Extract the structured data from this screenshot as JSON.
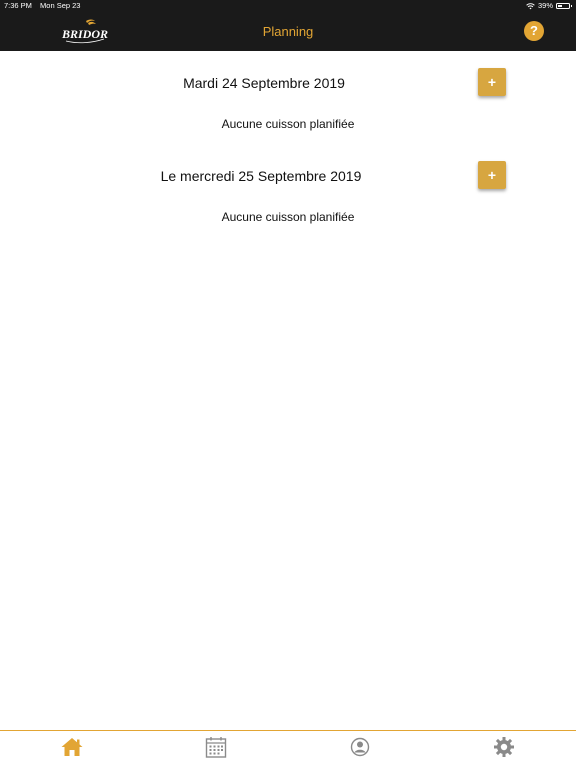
{
  "status_bar": {
    "time": "7:36 PM",
    "date": "Mon Sep 23",
    "battery": "39%",
    "battery_level": 0.39
  },
  "header": {
    "logo_text": "BRIDOR",
    "title": "Planning",
    "help_label": "?"
  },
  "days": [
    {
      "title": "Mardi 24 Septembre 2019",
      "add_label": "+",
      "empty_message": "Aucune cuisson planifiée"
    },
    {
      "title": "Le mercredi 25 Septembre 2019",
      "add_label": "+",
      "empty_message": "Aucune cuisson planifiée"
    }
  ],
  "tab_bar": {
    "active_tab": "home",
    "tabs": [
      {
        "id": "home",
        "icon": "home-icon"
      },
      {
        "id": "calendar",
        "icon": "calendar-icon"
      },
      {
        "id": "profile",
        "icon": "user-icon"
      },
      {
        "id": "settings",
        "icon": "gear-icon"
      }
    ]
  },
  "colors": {
    "accent": "#e2a534",
    "button": "#d7a640",
    "header_bg": "#1a1a1a",
    "inactive_icon": "#8a8a8a"
  }
}
